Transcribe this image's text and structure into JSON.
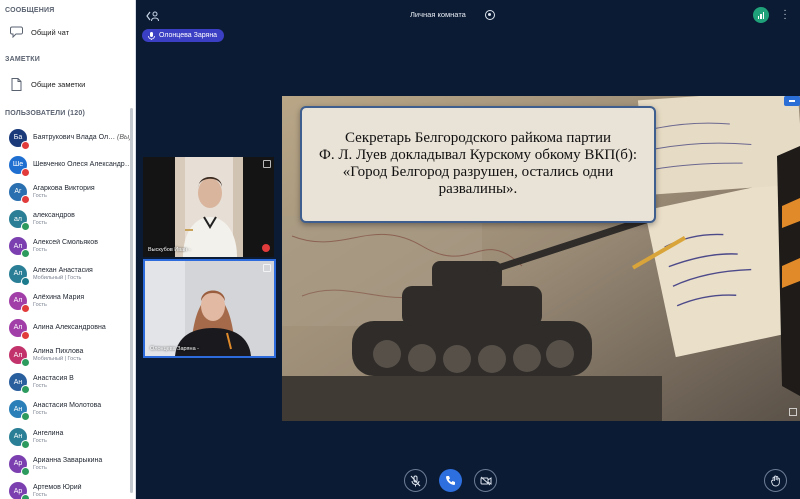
{
  "sidebar": {
    "messages_title": "СООБЩЕНИЯ",
    "general_chat": "Общий чат",
    "notes_title": "ЗАМЕТКИ",
    "shared_notes": "Общие заметки",
    "users_title": "ПОЛЬЗОВАТЕЛИ (120)",
    "users": [
      {
        "initials": "Ба",
        "name": "Баятрукович Влада Ол…",
        "you": "(Вы)",
        "role": "",
        "color": "#1a3a7a",
        "badge": "red"
      },
      {
        "initials": "Ше",
        "name": "Шевченко Олеся Александр…",
        "you": "",
        "role": "",
        "color": "#1f6fd1",
        "badge": "red"
      },
      {
        "initials": "Аг",
        "name": "Агаркова Виктория",
        "you": "",
        "role": "Гость",
        "color": "#2a6fb0",
        "badge": "red"
      },
      {
        "initials": "ал",
        "name": "александров",
        "you": "",
        "role": "Гость",
        "color": "#2a7f96",
        "badge": "green"
      },
      {
        "initials": "Ал",
        "name": "Алексей Смольяков",
        "you": "",
        "role": "Гость",
        "color": "#7b3fb0",
        "badge": "green"
      },
      {
        "initials": "Ал",
        "name": "Алехан Анастасия",
        "you": "",
        "role": "Мобильный | Гость",
        "color": "#2a7f96",
        "badge": "teal"
      },
      {
        "initials": "Ал",
        "name": "Алёхина Мария",
        "you": "",
        "role": "Гость",
        "color": "#a13ea8",
        "badge": "red"
      },
      {
        "initials": "Ал",
        "name": "Алина Александровна",
        "you": "",
        "role": "",
        "color": "#a13ea8",
        "badge": "red"
      },
      {
        "initials": "Ал",
        "name": "Алина Пихлова",
        "you": "",
        "role": "Мобильный | Гость",
        "color": "#c2336b",
        "badge": "green"
      },
      {
        "initials": "Ан",
        "name": "Анастасия В",
        "you": "",
        "role": "Гость",
        "color": "#2a5f9e",
        "badge": "green"
      },
      {
        "initials": "Ан",
        "name": "Анастасия Молотова",
        "you": "",
        "role": "Гость",
        "color": "#2a7fb8",
        "badge": "green"
      },
      {
        "initials": "Ан",
        "name": "Ангелина",
        "you": "",
        "role": "Гость",
        "color": "#2a7f96",
        "badge": "green"
      },
      {
        "initials": "Ар",
        "name": "Арианна Заварыкина",
        "you": "",
        "role": "Гость",
        "color": "#7b3fb0",
        "badge": "green"
      },
      {
        "initials": "Ар",
        "name": "Артемов Юрий",
        "you": "",
        "role": "Гость",
        "color": "#7b3fb0",
        "badge": "green"
      }
    ]
  },
  "topbar": {
    "room_title": "Личная комната"
  },
  "presenter_chip": "Олонцева Заряна",
  "videos": {
    "tile1_label": "Выскубов Иван -",
    "tile2_label": "Олонцева Заряна -"
  },
  "slide": {
    "lines": [
      "Секретарь Белгородского райкома партии",
      "Ф. Л. Луев докладывал Курскому обкому ВКП(б):",
      "«Город Белгород разрушен, остались одни",
      "развалины»."
    ]
  },
  "colors": {
    "background": "#0b1b33",
    "accent": "#2e6fe0",
    "chip": "#3b3fc4",
    "connection": "#1fa27a"
  }
}
